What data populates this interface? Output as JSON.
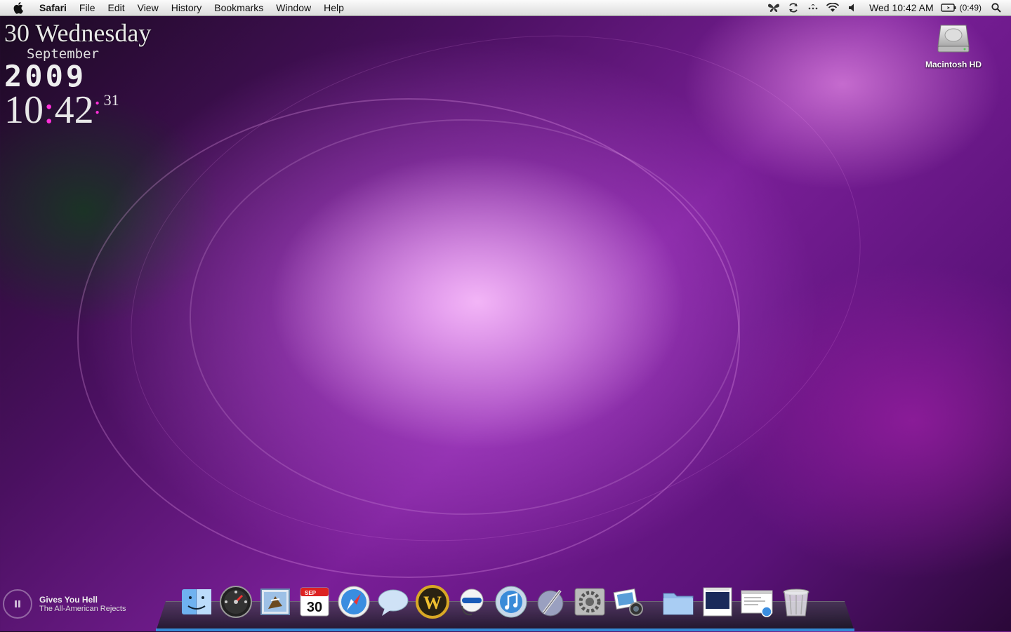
{
  "menubar": {
    "app_name": "Safari",
    "menus": [
      "File",
      "Edit",
      "View",
      "History",
      "Bookmarks",
      "Window",
      "Help"
    ],
    "status_icons": [
      "butterfly-icon",
      "sync-icon",
      "dots-icon",
      "wifi-icon",
      "volume-icon"
    ],
    "clock": "Wed 10:42 AM",
    "battery": "(0:49)"
  },
  "clock_widget": {
    "day": "30",
    "weekday": "Wednesday",
    "month": "September",
    "year": "2009",
    "hours": "10",
    "colon": ":",
    "minutes": "42",
    "seconds": "31"
  },
  "desktop": {
    "drive_label": "Macintosh HD"
  },
  "now_playing": {
    "title": "Gives You Hell",
    "artist": "The All-American Rejects"
  },
  "dock": {
    "calendar_month": "SEP",
    "calendar_day": "30",
    "items": [
      "finder-icon",
      "dashboard-icon",
      "mail-icon",
      "ical-icon",
      "safari-icon",
      "ichat-icon",
      "world-of-warcraft-icon",
      "headset-icon",
      "itunes-icon",
      "script-editor-icon",
      "system-preferences-icon",
      "iphoto-icon",
      "folder-icon",
      "document-icon",
      "mail-preview-icon",
      "trash-icon"
    ]
  }
}
